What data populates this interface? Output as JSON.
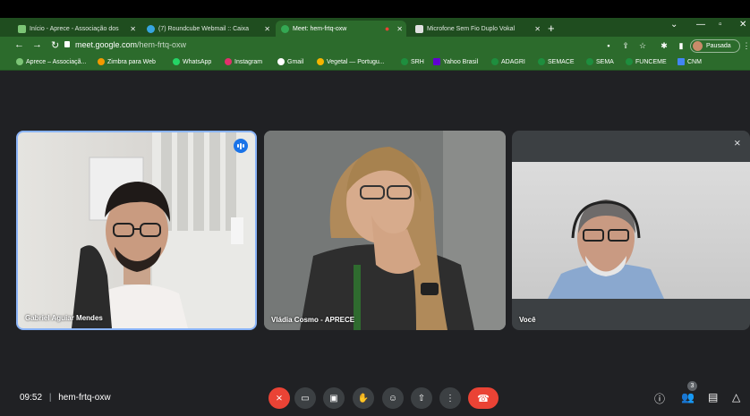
{
  "browser": {
    "tabs": [
      {
        "label": "Início - Aprece - Associação dos",
        "color": "#7cc576"
      },
      {
        "label": "(7) Roundcube Webmail :: Caixa",
        "color": "#37a5e0"
      },
      {
        "label": "Meet: hem-frtq-oxw",
        "color": "#34a853"
      },
      {
        "label": "Microfone Sem Fio Duplo Vokal",
        "color": "#e0e0e0"
      }
    ],
    "url_host": "meet.google.com",
    "url_path": "/hem-frtq-oxw",
    "profile_status": "Pausada"
  },
  "bookmarks": [
    {
      "label": "Aprece – Associaçã...",
      "color": "#7cc576"
    },
    {
      "label": "Zimbra para Web",
      "color": "#f29900"
    },
    {
      "label": "WhatsApp",
      "color": "#25d366"
    },
    {
      "label": "Instagram",
      "color": "#e1306c"
    },
    {
      "label": "Gmail",
      "color": "#ffffff"
    },
    {
      "label": "Vegetal — Portugu...",
      "color": "#f5b400"
    },
    {
      "label": "SRH",
      "color": "#1e8e3e"
    },
    {
      "label": "Yahoo Brasil",
      "color": "#6001d2"
    },
    {
      "label": "ADAGRI",
      "color": "#1e8e3e"
    },
    {
      "label": "SEMACE",
      "color": "#1e8e3e"
    },
    {
      "label": "SEMA",
      "color": "#1e8e3e"
    },
    {
      "label": "FUNCEME",
      "color": "#1e8e3e"
    },
    {
      "label": "CNM",
      "color": "#4285f4"
    }
  ],
  "meeting": {
    "time": "09:52",
    "code": "hem-frtq-oxw",
    "separator": "|",
    "participants_count": "3",
    "participants": [
      {
        "name": "Gabriel Aguiar Mendes"
      },
      {
        "name": "Vládia Cosmo - APRECE"
      },
      {
        "name": "Você"
      }
    ]
  }
}
